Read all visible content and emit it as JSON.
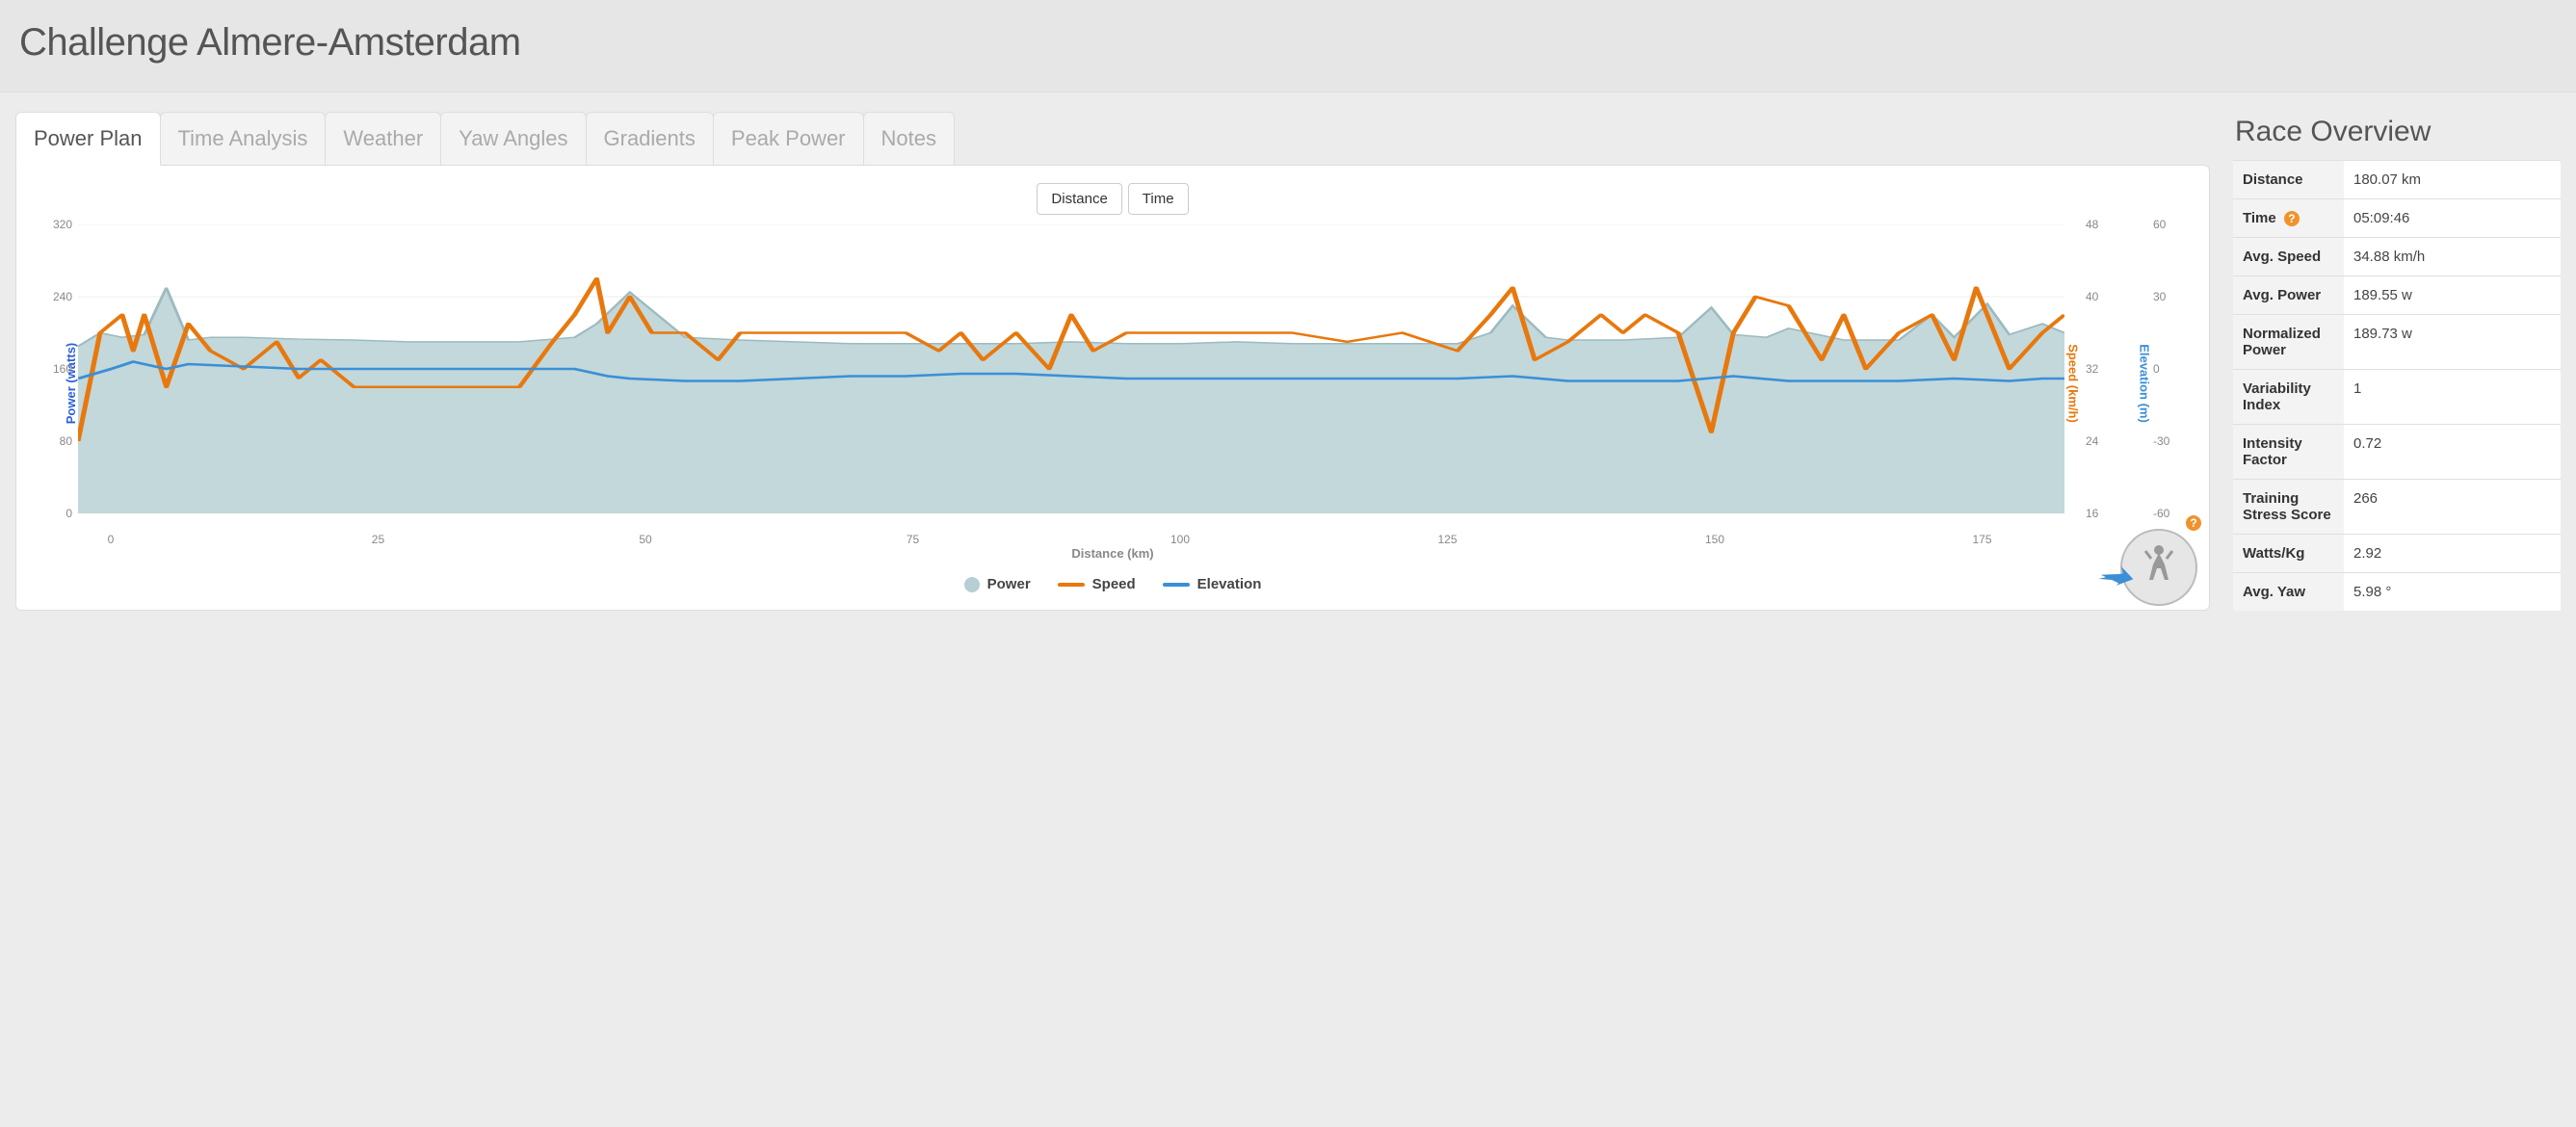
{
  "header": {
    "title": "Challenge Almere-Amsterdam"
  },
  "tabs": [
    {
      "label": "Power Plan",
      "active": true
    },
    {
      "label": "Time Analysis"
    },
    {
      "label": "Weather"
    },
    {
      "label": "Yaw Angles"
    },
    {
      "label": "Gradients"
    },
    {
      "label": "Peak Power"
    },
    {
      "label": "Notes"
    }
  ],
  "toggle": {
    "distance": "Distance",
    "time": "Time"
  },
  "legend": {
    "power": "Power",
    "speed": "Speed",
    "elevation": "Elevation"
  },
  "overview": {
    "title": "Race Overview",
    "rows": [
      {
        "label": "Distance",
        "value": "180.07 km"
      },
      {
        "label": "Time",
        "value": "05:09:46",
        "help": true
      },
      {
        "label": "Avg. Speed",
        "value": "34.88 km/h"
      },
      {
        "label": "Avg. Power",
        "value": "189.55 w"
      },
      {
        "label": "Normalized Power",
        "value": "189.73 w"
      },
      {
        "label": "Variability Index",
        "value": "1"
      },
      {
        "label": "Intensity Factor",
        "value": "0.72"
      },
      {
        "label": "Training Stress Score",
        "value": "266"
      },
      {
        "label": "Watts/Kg",
        "value": "2.92"
      },
      {
        "label": "Avg. Yaw",
        "value": "5.98 °"
      }
    ]
  },
  "colors": {
    "power_fill": "#c2d8db",
    "power_stroke": "#9cbabf",
    "speed": "#e8780d",
    "elevation": "#3b8fd6",
    "grid": "#eeeeee"
  },
  "chart_data": {
    "type": "line",
    "title": "",
    "xlabel": "Distance (km)",
    "xlim": [
      0,
      180
    ],
    "x_ticks": [
      0,
      25,
      50,
      75,
      100,
      125,
      150,
      175
    ],
    "y_left": {
      "label": "Power (watts)",
      "lim": [
        0,
        320
      ],
      "ticks": [
        0,
        80,
        160,
        240,
        320
      ]
    },
    "y_right1": {
      "label": "Speed (km/h)",
      "lim": [
        16,
        48
      ],
      "ticks": [
        16,
        24,
        32,
        40,
        48
      ]
    },
    "y_right2": {
      "label": "Elevation (m)",
      "lim": [
        -60,
        60
      ],
      "ticks": [
        -60,
        -30,
        0,
        30,
        60
      ]
    },
    "series": [
      {
        "name": "Power",
        "axis": "y_left",
        "style": "area",
        "x": [
          0,
          2,
          4,
          6,
          8,
          10,
          12,
          15,
          20,
          25,
          30,
          35,
          40,
          45,
          47,
          50,
          55,
          60,
          65,
          70,
          75,
          80,
          85,
          90,
          95,
          100,
          105,
          110,
          115,
          120,
          125,
          128,
          130,
          133,
          135,
          140,
          145,
          148,
          150,
          153,
          155,
          160,
          165,
          168,
          170,
          173,
          175,
          178,
          180
        ],
        "values": [
          185,
          200,
          195,
          198,
          250,
          192,
          195,
          195,
          193,
          192,
          190,
          190,
          190,
          195,
          210,
          245,
          195,
          192,
          190,
          188,
          188,
          188,
          188,
          190,
          188,
          188,
          190,
          188,
          188,
          188,
          188,
          200,
          230,
          195,
          192,
          192,
          195,
          228,
          198,
          195,
          205,
          192,
          192,
          220,
          195,
          232,
          198,
          210,
          200
        ]
      },
      {
        "name": "Speed",
        "axis": "y_right1",
        "style": "line",
        "x": [
          0,
          2,
          4,
          5,
          6,
          8,
          10,
          12,
          15,
          18,
          20,
          22,
          25,
          30,
          35,
          40,
          43,
          45,
          47,
          48,
          50,
          52,
          55,
          58,
          60,
          65,
          70,
          75,
          78,
          80,
          82,
          85,
          88,
          90,
          92,
          95,
          100,
          105,
          110,
          115,
          120,
          125,
          128,
          130,
          132,
          135,
          138,
          140,
          142,
          145,
          148,
          150,
          152,
          155,
          158,
          160,
          162,
          165,
          168,
          170,
          172,
          175,
          178,
          180
        ],
        "values": [
          24,
          36,
          38,
          34,
          38,
          30,
          37,
          34,
          32,
          35,
          31,
          33,
          30,
          30,
          30,
          30,
          35,
          38,
          42,
          36,
          40,
          36,
          36,
          33,
          36,
          36,
          36,
          36,
          34,
          36,
          33,
          36,
          32,
          38,
          34,
          36,
          36,
          36,
          36,
          35,
          36,
          34,
          38,
          41,
          33,
          35,
          38,
          36,
          38,
          36,
          25,
          36,
          40,
          39,
          33,
          38,
          32,
          36,
          38,
          33,
          41,
          32,
          36,
          38
        ]
      },
      {
        "name": "Elevation",
        "axis": "y_right2",
        "style": "line",
        "x": [
          0,
          3,
          5,
          8,
          10,
          15,
          20,
          25,
          30,
          35,
          40,
          45,
          48,
          50,
          55,
          60,
          65,
          70,
          75,
          80,
          85,
          90,
          95,
          100,
          105,
          110,
          115,
          120,
          125,
          130,
          135,
          140,
          145,
          150,
          155,
          160,
          165,
          170,
          175,
          178,
          180
        ],
        "values": [
          -4,
          0,
          3,
          0,
          2,
          1,
          0,
          0,
          0,
          0,
          0,
          0,
          -3,
          -4,
          -5,
          -5,
          -4,
          -3,
          -3,
          -2,
          -2,
          -3,
          -4,
          -4,
          -4,
          -4,
          -4,
          -4,
          -4,
          -3,
          -5,
          -5,
          -5,
          -3,
          -5,
          -5,
          -5,
          -4,
          -5,
          -4,
          -4
        ]
      }
    ]
  }
}
